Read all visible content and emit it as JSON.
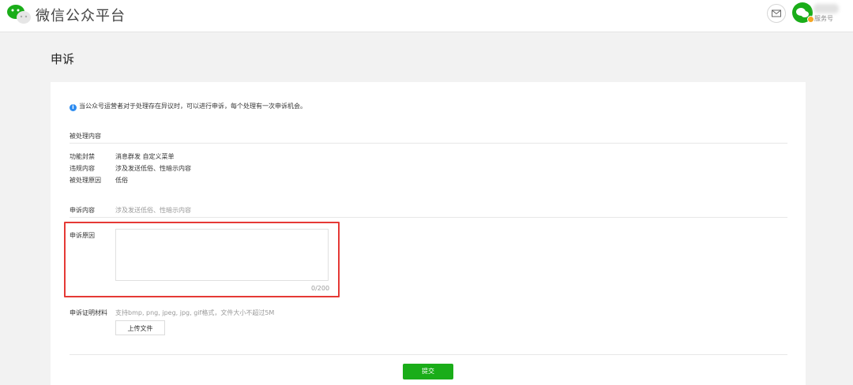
{
  "header": {
    "brand": "微信公众平台",
    "account_type": "服务号"
  },
  "page": {
    "title": "申诉"
  },
  "notice": "当公众号运营者对于处理存在异议时，可以进行申诉，每个处理有一次申诉机会。",
  "processed": {
    "section_title": "被处理内容",
    "rows": [
      {
        "label": "功能封禁",
        "value": "消息群发 自定义菜单"
      },
      {
        "label": "违规内容",
        "value": "涉及发送低俗、性暗示内容"
      },
      {
        "label": "被处理原因",
        "value": "低俗"
      }
    ]
  },
  "appeal": {
    "content_label": "申诉内容",
    "content_value": "涉及发送低俗、性暗示内容",
    "reason_label": "申诉原因",
    "reason_value": "",
    "reason_counter": "0/200",
    "proof_label": "申诉证明材料",
    "proof_hint": "支持bmp, png, jpeg, jpg, gif格式，文件大小不超过5M",
    "upload_label": "上传文件",
    "submit_label": "提交"
  },
  "colors": {
    "accent": "#1aad19",
    "highlight": "#e53935",
    "info": "#2d8cf0"
  }
}
